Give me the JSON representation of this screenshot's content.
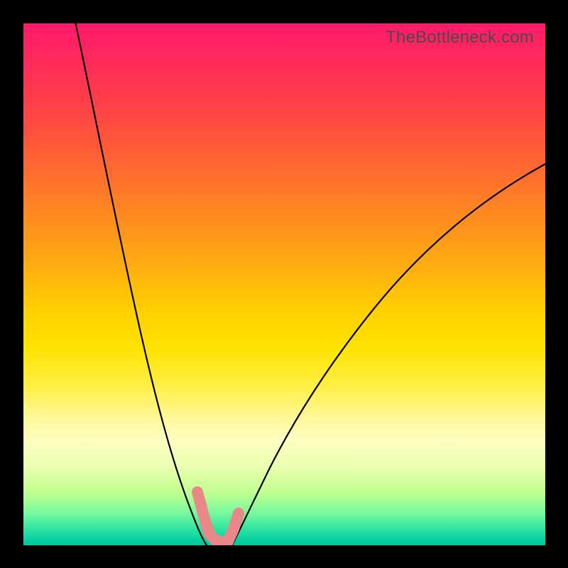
{
  "watermark": "TheBottleneck.com",
  "chart_data": {
    "type": "line",
    "title": "",
    "xlabel": "",
    "ylabel": "",
    "xlim": [
      0,
      100
    ],
    "ylim": [
      0,
      100
    ],
    "grid": false,
    "legend": false,
    "series": [
      {
        "name": "left-curve",
        "x": [
          10,
          15,
          20,
          24,
          27,
          29.5,
          31,
          32.5,
          34,
          35
        ],
        "values": [
          100,
          79,
          56,
          37,
          23,
          14,
          8,
          4,
          1,
          0
        ]
      },
      {
        "name": "right-curve",
        "x": [
          40,
          42,
          45,
          50,
          56,
          63,
          71,
          80,
          90,
          100
        ],
        "values": [
          0,
          3,
          8,
          17,
          27,
          37,
          47,
          56,
          65,
          73
        ]
      }
    ],
    "annotations": [
      {
        "name": "pink-marker",
        "type": "scatter",
        "x": [
          33.5,
          34.5,
          35.5,
          36.5,
          39,
          40,
          41
        ],
        "values": [
          10,
          6,
          2,
          0.5,
          0.5,
          2,
          6
        ],
        "color": "#e98888"
      }
    ]
  }
}
